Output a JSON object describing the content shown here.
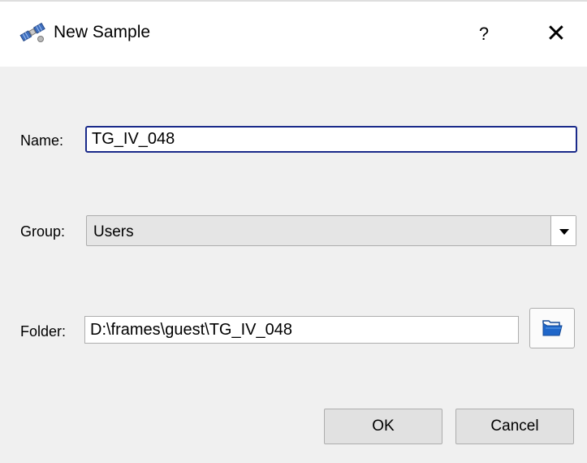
{
  "window": {
    "title": "New Sample",
    "help_label": "?",
    "close_label": "✕",
    "icon": "satellite-icon"
  },
  "form": {
    "name_label": "Name:",
    "name_value": "TG_IV_048",
    "group_label": "Group:",
    "group_value": "Users",
    "folder_label": "Folder:",
    "folder_value": "D:\\frames\\guest\\TG_IV_048",
    "browse_icon": "folder-open-icon"
  },
  "buttons": {
    "ok": "OK",
    "cancel": "Cancel"
  },
  "colors": {
    "focus_border": "#1a2a8a",
    "dialog_background": "#f0f0f0"
  }
}
